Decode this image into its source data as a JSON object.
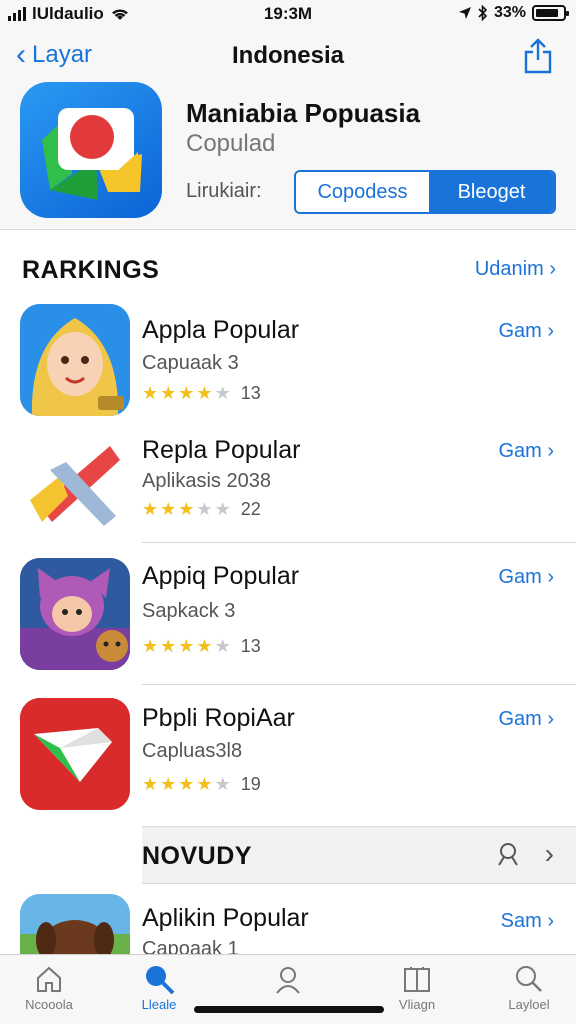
{
  "status": {
    "carrier": "lUldaulio",
    "time": "19:3M",
    "battery": "33%",
    "battery_level": 0.85
  },
  "nav": {
    "back_label": "Layar",
    "title": "Indonesia"
  },
  "hero": {
    "title": "Maniabia Popuasia",
    "subtitle": "Copulad",
    "label": "Lirukiair:",
    "seg_left": "Copodess",
    "seg_right": "Bleoget"
  },
  "rankings": {
    "title": "RARKINGS",
    "see_all": "Udanim",
    "apps": [
      {
        "name": "Appla Popular",
        "subtitle": "Capuaak 3",
        "rating": 4,
        "count": "13",
        "action": "Gam"
      },
      {
        "name": "Repla Popular",
        "subtitle": "Aplikasis 2038",
        "rating": 3,
        "count": "22",
        "action": "Gam"
      },
      {
        "name": "Appiq Popular",
        "subtitle": "Sapkack 3",
        "rating": 4,
        "count": "13",
        "action": "Gam"
      },
      {
        "name": "Pbpli RopiAar",
        "subtitle": "Capluas3l8",
        "rating": 4,
        "count": "19",
        "action": "Gam"
      }
    ]
  },
  "section2": {
    "title": "NOVUDY",
    "apps": [
      {
        "name": "Aplikin Popular",
        "subtitle": "Capoaak 1",
        "action": "Sam"
      }
    ]
  },
  "tabbar": {
    "tabs": [
      {
        "label": "Ncooola"
      },
      {
        "label": "Lleale"
      },
      {
        "label": ""
      },
      {
        "label": "Vliagn"
      },
      {
        "label": "Layloel"
      }
    ],
    "active_index": 1
  },
  "colors": {
    "accent": "#1a73d8",
    "star": "#f2c01a"
  }
}
